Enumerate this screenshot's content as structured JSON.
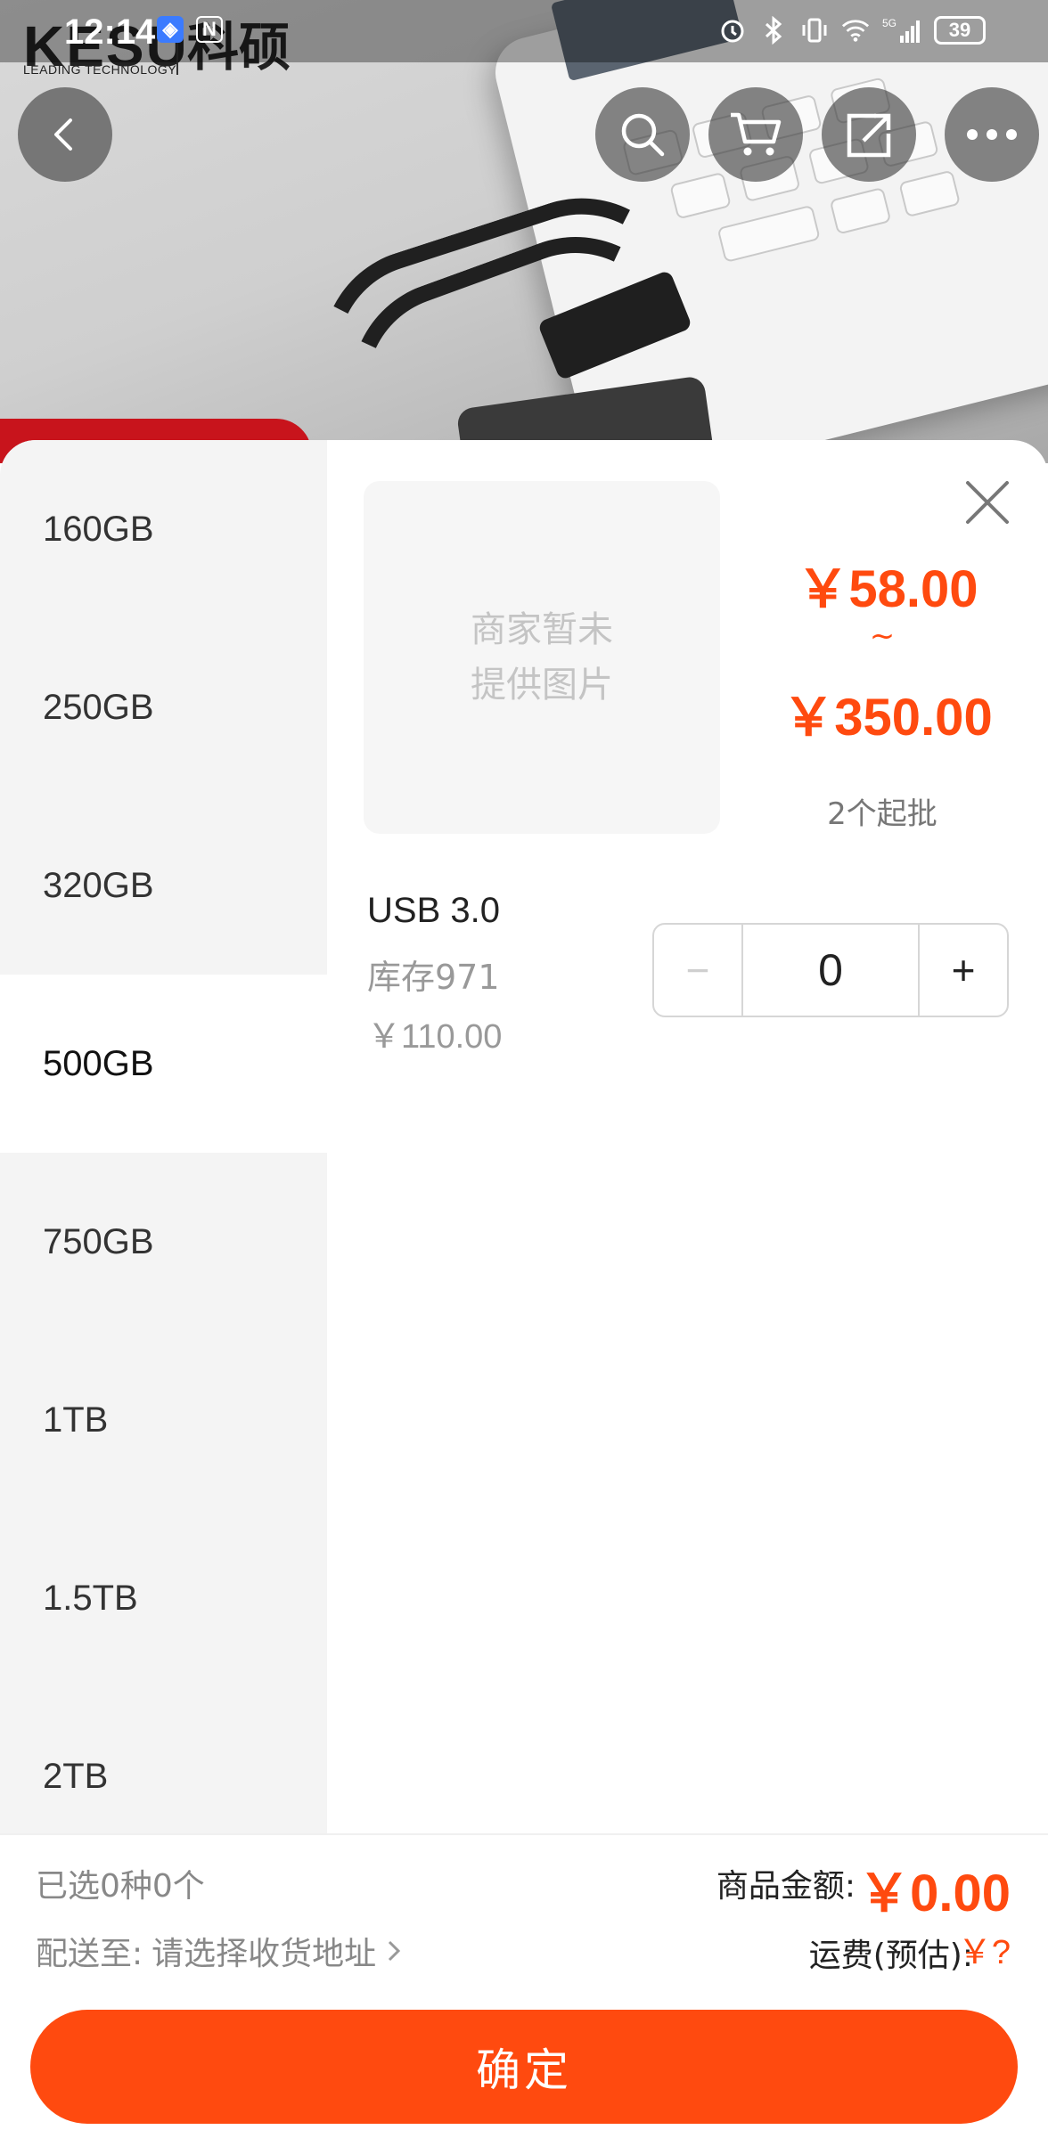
{
  "status_bar": {
    "time": "12:14",
    "battery": "39",
    "network": "5G"
  },
  "hero": {
    "brand": "KESU",
    "brand_cn": "科硕",
    "brand_tagline": "LEADING TECHNOLOGY"
  },
  "top_nav": {
    "icons": [
      "back-icon",
      "search-icon",
      "cart-icon",
      "share-icon",
      "more-icon"
    ]
  },
  "sidebar": {
    "items": [
      {
        "label": "160GB"
      },
      {
        "label": "250GB"
      },
      {
        "label": "320GB"
      },
      {
        "label": "500GB",
        "active": true
      },
      {
        "label": "750GB"
      },
      {
        "label": "1TB"
      },
      {
        "label": "1.5TB"
      },
      {
        "label": "2TB"
      }
    ]
  },
  "product": {
    "image_placeholder_line1": "商家暂未",
    "image_placeholder_line2": "提供图片",
    "price_min": "￥58.00",
    "price_sep": "~",
    "price_max": "￥350.00",
    "min_batch": "2个起批"
  },
  "variant": {
    "name": "USB 3.0",
    "stock": "库存971",
    "price": "￥110.00",
    "quantity": "0",
    "minus_label": "−",
    "plus_label": "+"
  },
  "footer": {
    "selected_text": "已选0种0个",
    "delivery_label": "配送至:",
    "delivery_value": "请选择收货地址",
    "amount_label": "商品金额:",
    "amount_value": "￥0.00",
    "freight_label": "运费(预估):",
    "freight_value": "￥?",
    "confirm_label": "确定"
  },
  "colors": {
    "accent": "#ff4a0f",
    "sidebar_bg": "#f4f4f4"
  }
}
